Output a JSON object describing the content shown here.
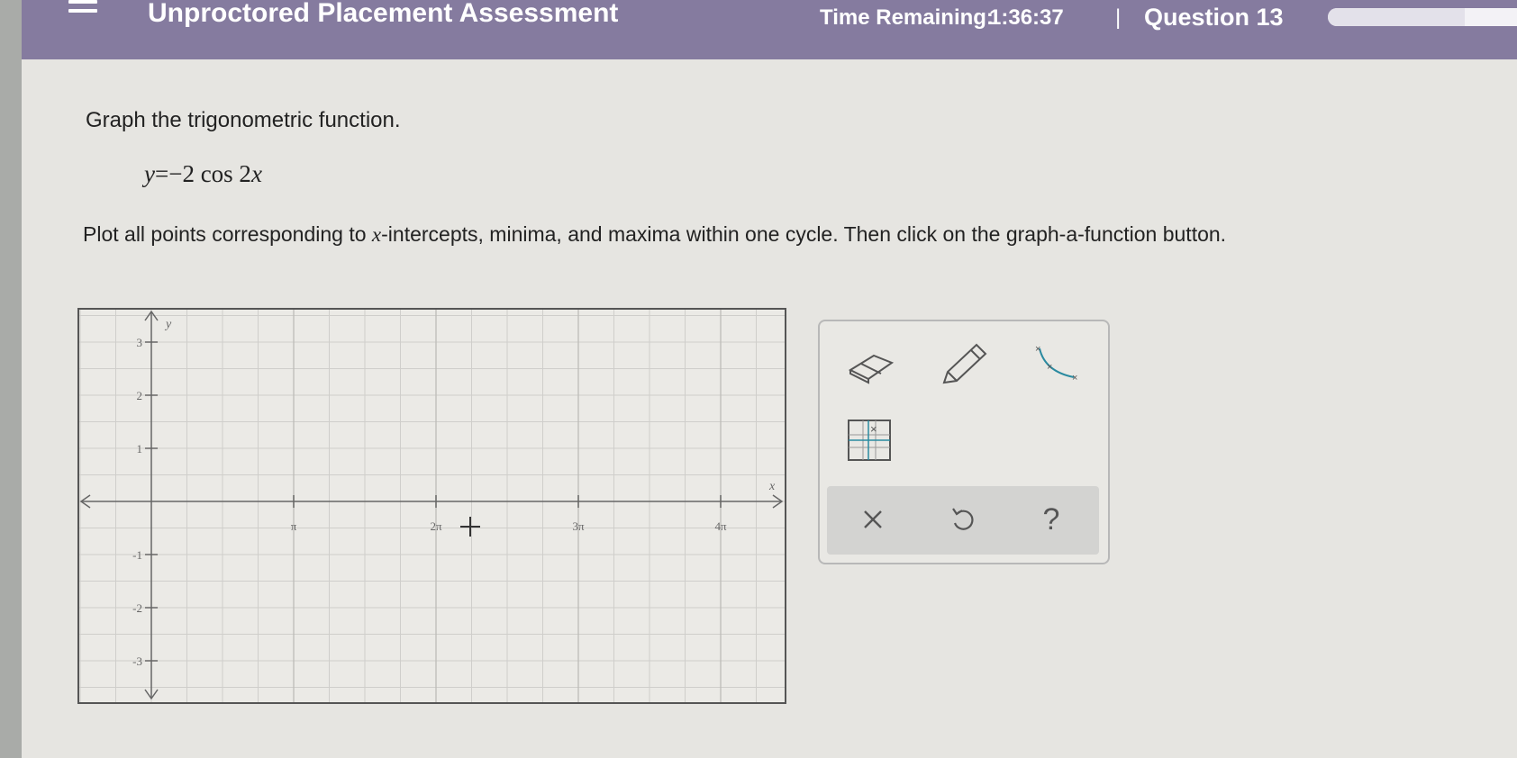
{
  "header": {
    "title": "Unproctored Placement Assessment",
    "timer_label": "Time Remaining:",
    "timer_value": "1:36:37",
    "separator": "|",
    "question_label": "Question 13",
    "progress_fraction": 0.65
  },
  "problem": {
    "prompt": "Graph the trigonometric function.",
    "equation": {
      "lhs": "y",
      "equals": "=",
      "rhs_coef": "−2 cos 2",
      "rhs_var": "x"
    },
    "instructions_before": "Plot all points corresponding to ",
    "instructions_var": "x",
    "instructions_after": "-intercepts, minima, and maxima within one cycle. Then click on the graph-a-function button."
  },
  "graph": {
    "y_axis_label": "y",
    "x_axis_label": "x",
    "y_ticks": [
      "3",
      "2",
      "1",
      "-1",
      "-2",
      "-3"
    ],
    "x_ticks": [
      "π",
      "2π",
      "3π",
      "4π"
    ]
  },
  "toolbox": {
    "tools": [
      "eraser-icon",
      "pencil-icon",
      "graph-a-function-icon",
      "point-grid-icon"
    ],
    "actions": [
      "clear-icon",
      "undo-icon",
      "help-icon"
    ],
    "help_label": "?"
  }
}
